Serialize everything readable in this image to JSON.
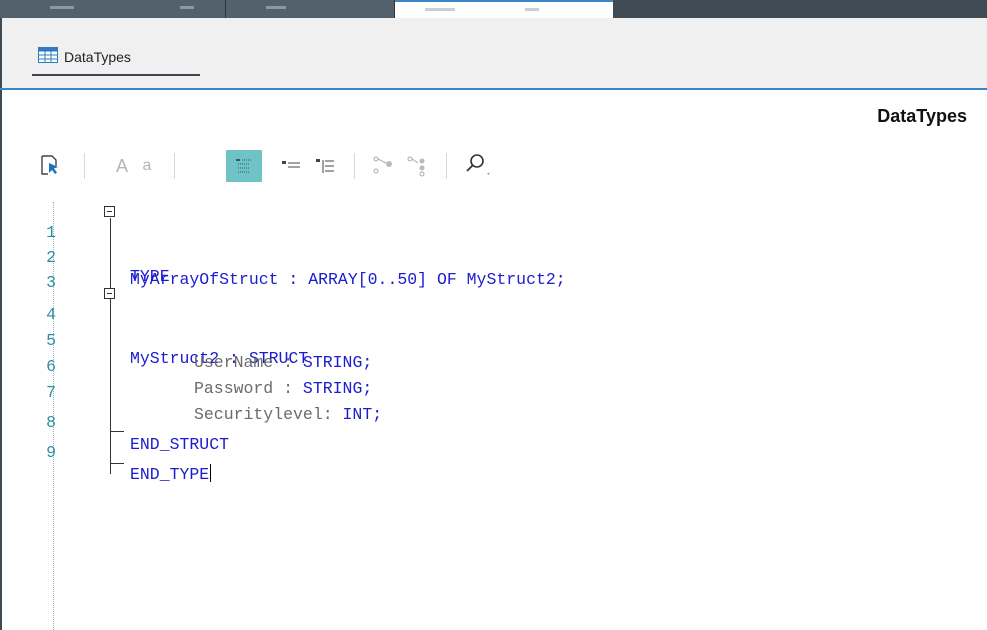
{
  "doc_tab": {
    "label": "DataTypes",
    "icon": "table-icon"
  },
  "editor": {
    "title": "DataTypes"
  },
  "toolbar": {
    "tools": [
      {
        "name": "select-cursor-icon"
      },
      {
        "name": "font-larger-icon",
        "label": "A"
      },
      {
        "name": "font-smaller-icon",
        "label": "a"
      },
      {
        "name": "view-outline-icon",
        "active": true
      },
      {
        "name": "indent-decrease-icon"
      },
      {
        "name": "indent-increase-icon"
      },
      {
        "name": "connect-nodes-icon"
      },
      {
        "name": "branch-nodes-icon"
      },
      {
        "name": "search-icon"
      }
    ]
  },
  "code": {
    "lines": [
      {
        "n": "1",
        "text": "TYPE"
      },
      {
        "n": "2",
        "text": "MyArrayOfStruct : ARRAY[0..50] OF MyStruct2;"
      },
      {
        "n": "3",
        "text": ""
      },
      {
        "n": "4",
        "text": "MyStruct2 : STRUCT"
      },
      {
        "n": "5",
        "ident": "UserName :",
        "type": " STRING;"
      },
      {
        "n": "6",
        "ident": "Password :",
        "type": " STRING;"
      },
      {
        "n": "7",
        "ident": "Securitylevel:",
        "type": " INT;"
      },
      {
        "n": "8",
        "text": "END_STRUCT"
      },
      {
        "n": "9",
        "text": "END_TYPE"
      }
    ]
  },
  "colors": {
    "keyword": "#1b1bd0",
    "identifier": "#6b6b6b",
    "line_number": "#2d8f9e",
    "accent": "#3a86c8",
    "active_tool": "#6fc2c6"
  }
}
